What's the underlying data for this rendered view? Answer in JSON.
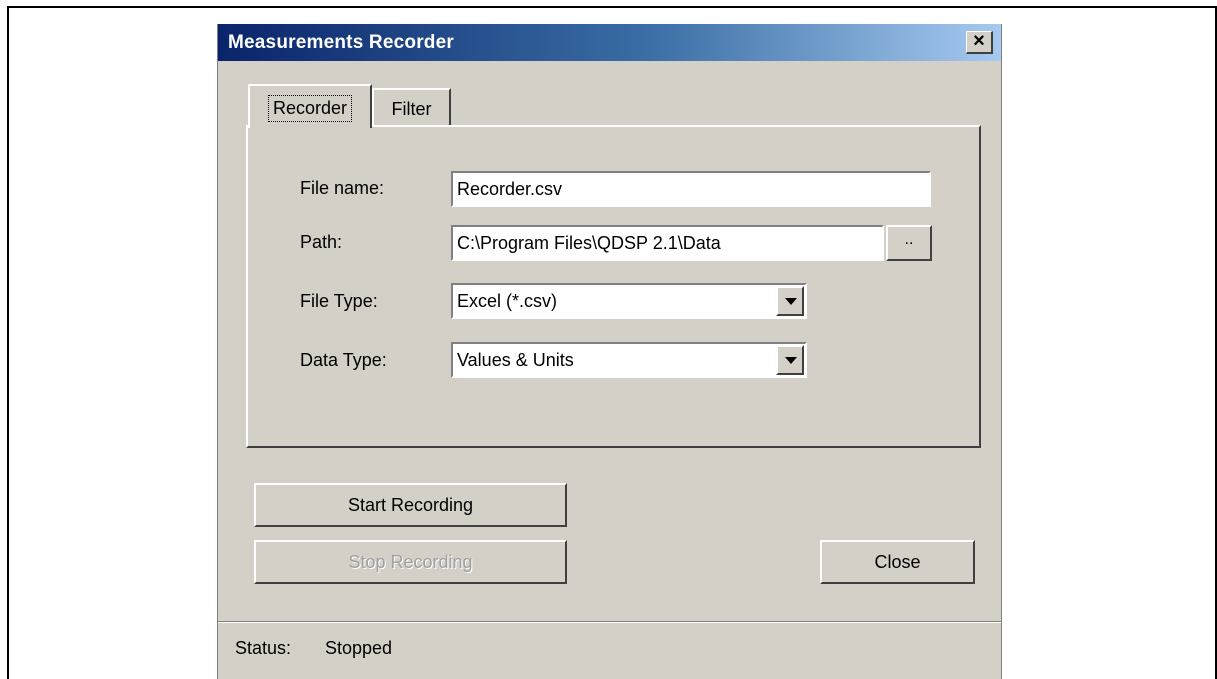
{
  "window": {
    "title": "Measurements Recorder",
    "close_glyph": "×"
  },
  "tabs": [
    {
      "label": "Recorder",
      "active": true
    },
    {
      "label": "Filter",
      "active": false
    }
  ],
  "form": {
    "file_name": {
      "label": "File name:",
      "value": "Recorder.csv"
    },
    "path": {
      "label": "Path:",
      "value": "C:\\Program Files\\QDSP 2.1\\Data",
      "browse_label": ".."
    },
    "file_type": {
      "label": "File Type:",
      "value": "Excel (*.csv)"
    },
    "data_type": {
      "label": "Data Type:",
      "value": "Values & Units"
    }
  },
  "buttons": {
    "start": "Start Recording",
    "stop": "Stop Recording",
    "close": "Close"
  },
  "status": {
    "label": "Status:",
    "value": "Stopped"
  },
  "colors": {
    "dialog_face": "#d4d0c8",
    "titlebar_start": "#0a246a",
    "titlebar_end": "#a6caf0",
    "disabled_text": "#a0a0a0"
  },
  "icons": {
    "close": "close-icon",
    "dropdown": "chevron-down-icon"
  }
}
